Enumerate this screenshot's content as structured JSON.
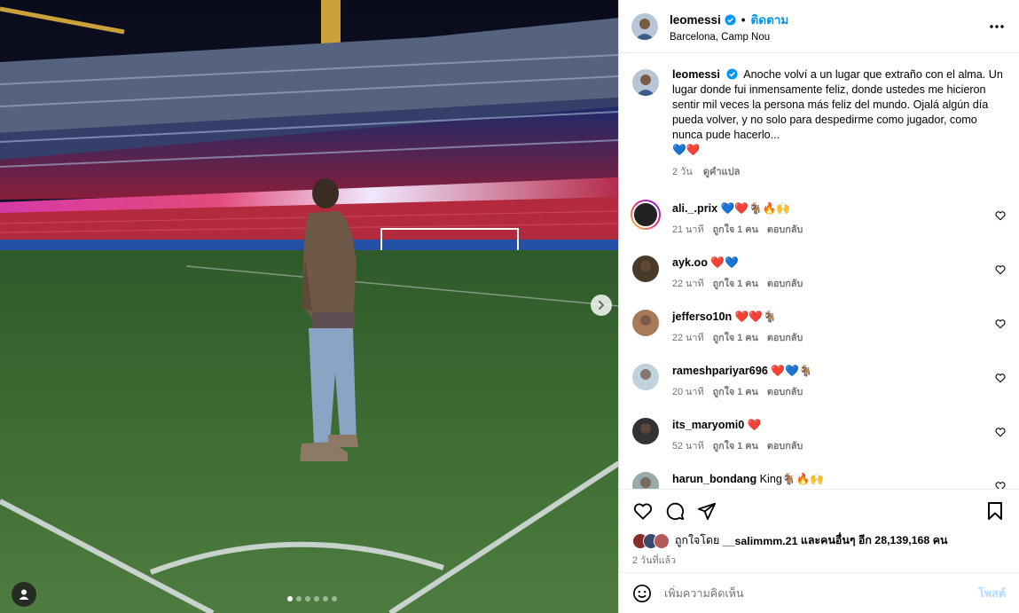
{
  "header": {
    "username": "leomessi",
    "separator": "•",
    "follow_label": "ติดตาม",
    "location": "Barcelona, Camp Nou"
  },
  "caption": {
    "username": "leomessi",
    "text": "Anoche volví a un lugar que extraño con el alma. Un lugar donde fui inmensamente feliz, donde ustedes me hicieron sentir mil veces la persona más feliz del mundo. Ojalá algún día pueda volver, y no solo para despedirme como jugador, como nunca pude hacerlo...",
    "emoji": "💙❤️",
    "age": "2 วัน",
    "translate_label": "ดูคำแปล"
  },
  "comments": [
    {
      "username": "ali._.prix",
      "text": "💙❤️🐐🔥🙌",
      "age": "21 นาที",
      "likes": "ถูกใจ 1 คน",
      "reply": "ตอบกลับ"
    },
    {
      "username": "ayk.oo",
      "text": "❤️💙",
      "age": "22 นาที",
      "likes": "ถูกใจ 1 คน",
      "reply": "ตอบกลับ"
    },
    {
      "username": "jefferso10n",
      "text": "❤️❤️🐐",
      "age": "22 นาที",
      "likes": "ถูกใจ 1 คน",
      "reply": "ตอบกลับ"
    },
    {
      "username": "rameshpariyar696",
      "text": "❤️💙🐐",
      "age": "20 นาที",
      "likes": "ถูกใจ 1 คน",
      "reply": "ตอบกลับ"
    },
    {
      "username": "its_maryomi0",
      "text": "❤️",
      "age": "52 นาที",
      "likes": "ถูกใจ 1 คน",
      "reply": "ตอบกลับ"
    },
    {
      "username": "harun_bondang",
      "text": "King🐐🔥🙌",
      "age": "",
      "likes": "",
      "reply": ""
    }
  ],
  "likes_summary": {
    "prefix": "ถูกใจโดย",
    "user": "__salimmm.21",
    "suffix": "และคนอื่นๆ อีก 28,139,168 คน"
  },
  "post_time": "2 วันที่แล้ว",
  "add_comment": {
    "placeholder": "เพิ่มความคิดเห็น",
    "post_label": "โพสต์"
  },
  "carousel": {
    "slide_count": 6,
    "active_index": 0
  },
  "colors": {
    "accent": "#0095f6",
    "verified": "#0095f6",
    "post_disabled": "#b3dbff",
    "muted_text": "#737373"
  },
  "icons": [
    "verified-badge-icon",
    "more-options-icon",
    "heart-icon",
    "comment-icon",
    "share-icon",
    "bookmark-icon",
    "emoji-icon",
    "chevron-right-icon",
    "user-tag-icon"
  ]
}
